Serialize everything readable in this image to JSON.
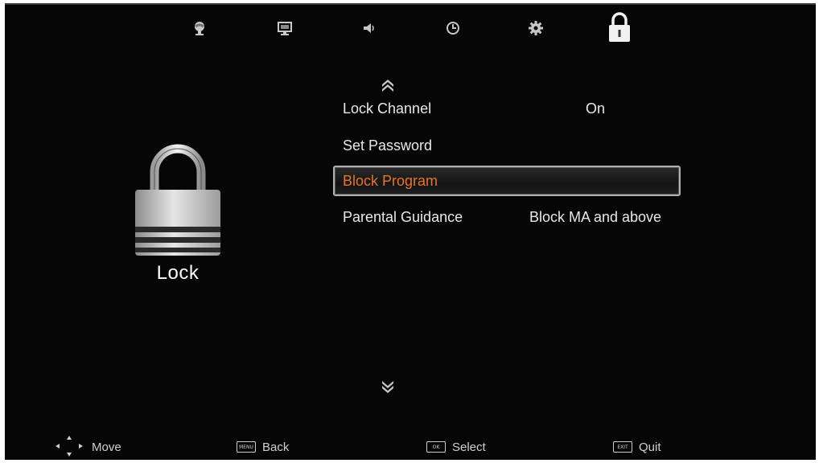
{
  "tabs": [
    {
      "icon": "picture-icon",
      "label": ""
    },
    {
      "icon": "display-icon",
      "label": ""
    },
    {
      "icon": "sound-icon",
      "label": ""
    },
    {
      "icon": "clock-icon",
      "label": ""
    },
    {
      "icon": "gear-icon",
      "label": ""
    },
    {
      "icon": "lock-icon",
      "label": "",
      "active": true
    }
  ],
  "hero": {
    "icon": "lock-icon",
    "title": "Lock"
  },
  "menu": {
    "items": [
      {
        "label": "Lock Channel",
        "value": "On"
      },
      {
        "label": "Set Password",
        "value": ""
      },
      {
        "label": "Block Program",
        "value": "",
        "selected": true
      },
      {
        "label": "Parental Guidance",
        "value": "Block MA and above"
      }
    ]
  },
  "hints": {
    "move": "Move",
    "back": "Back",
    "back_key": "MENU",
    "select": "Select",
    "select_key": "OK",
    "quit": "Quit",
    "quit_key": "EXIT"
  },
  "colors": {
    "background": "#060606",
    "text": "#e8e8e8",
    "selected_text": "#e8742a",
    "highlight_border": "#b0b0b0"
  }
}
